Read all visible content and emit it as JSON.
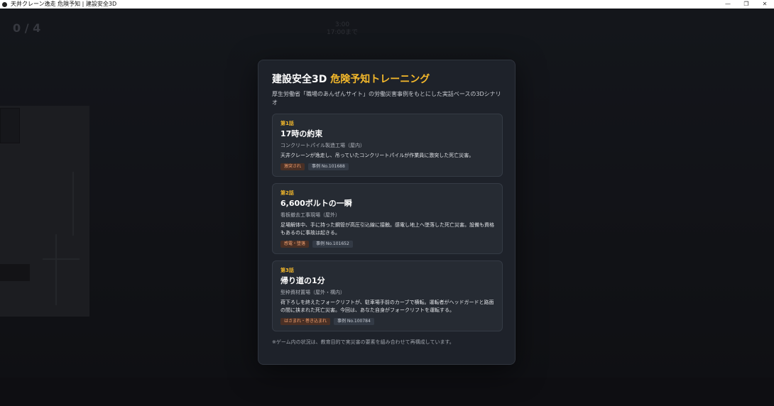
{
  "window": {
    "title": "天井クレーン逸走 危険予知 | 建設安全3D",
    "minimize_glyph": "—",
    "restore_glyph": "❐",
    "close_glyph": "✕"
  },
  "hud": {
    "counter": "0 / 4",
    "timer": "3:00",
    "timer_sub": "17:00まで"
  },
  "modal": {
    "title_main": "建設安全3D ",
    "title_accent": "危険予知トレーニング",
    "subtitle": "厚生労働省「職場のあんぜんサイト」の労働災害事例をもとにした実話ベースの3Dシナリオ",
    "footnote": "※ゲーム内の状況は、教育目的で実災害の要素を組み合わせて再構成しています。",
    "episodes": [
      {
        "number": "第1話",
        "title": "17時の約束",
        "location": "コンクリートパイル製造工場（屋内）",
        "description": "天井クレーンが逸走し、吊っていたコンクリートパイルが作業員に激突した死亡災害。",
        "hazard_tag": "激突され",
        "case_tag": "事例 No.101688"
      },
      {
        "number": "第2話",
        "title": "6,600ボルトの一瞬",
        "location": "看板撤去工事現場（屋外）",
        "description": "足場解体中、手に持った鋼管が高圧引込線に接触。感電し地上へ墜落した死亡災害。設備も資格もあるのに事故は起きる。",
        "hazard_tag": "感電・墜落",
        "case_tag": "事例 No.101652"
      },
      {
        "number": "第3話",
        "title": "帰り道の1分",
        "location": "型枠資材置場（屋外・構内）",
        "description": "荷下ろしを終えたフォークリフトが、駐車場手前のカーブで横転。運転者がヘッドガードと路面の間に挟まれた死亡災害。今回は、あなた自身がフォークリフトを運転する。",
        "hazard_tag": "はさまれ・巻き込まれ",
        "case_tag": "事例 No.100784"
      }
    ]
  }
}
